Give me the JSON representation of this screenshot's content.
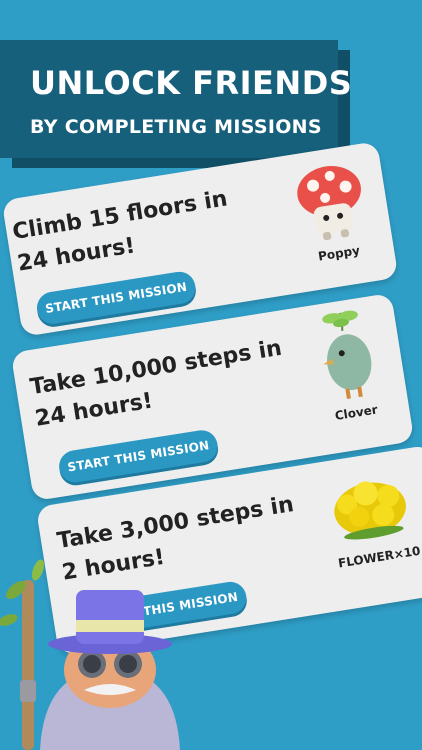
{
  "header": {
    "title": "UNLOCK FRIENDS",
    "subtitle": "BY COMPLETING MISSIONS"
  },
  "missions": [
    {
      "text": "Climb 15 floors in\n24 hours!",
      "button_label": "START THIS MISSION",
      "reward_name": "Poppy",
      "reward_icon": "mushroom-character-icon"
    },
    {
      "text": "Take 10,000 steps in\n24 hours!",
      "button_label": "START THIS MISSION",
      "reward_name": "Clover",
      "reward_icon": "bird-character-icon"
    },
    {
      "text": "Take 3,000 steps in\n2 hours!",
      "button_label": "START THIS MISSION",
      "reward_name": "FLOWER×10",
      "reward_icon": "flower-bush-icon"
    }
  ],
  "colors": {
    "background": "#2f9ec7",
    "banner": "#16607b",
    "card": "#eeeeee",
    "button": "#2b98c4"
  }
}
